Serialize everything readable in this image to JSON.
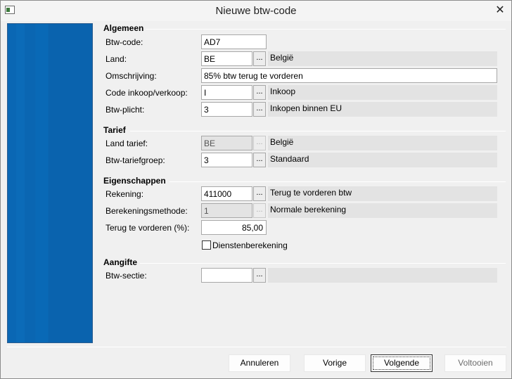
{
  "window": {
    "title": "Nieuwe btw-code",
    "close_glyph": "✕"
  },
  "sections": {
    "algemeen": "Algemeen",
    "tarief": "Tarief",
    "eigenschappen": "Eigenschappen",
    "aangifte": "Aangifte"
  },
  "form": {
    "btw_code": {
      "label": "Btw-code:",
      "value": "AD7"
    },
    "land": {
      "label": "Land:",
      "value": "BE",
      "description": "België"
    },
    "omschrijving": {
      "label": "Omschrijving:",
      "value": "85% btw terug te vorderen"
    },
    "code_inkoop_verkoop": {
      "label": "Code inkoop/verkoop:",
      "value": "I",
      "description": "Inkoop"
    },
    "btw_plicht": {
      "label": "Btw-plicht:",
      "value": "3",
      "description": "Inkopen binnen EU"
    },
    "land_tarief": {
      "label": "Land tarief:",
      "value": "BE",
      "description": "België"
    },
    "btw_tariefgroep": {
      "label": "Btw-tariefgroep:",
      "value": "3",
      "description": "Standaard"
    },
    "rekening": {
      "label": "Rekening:",
      "value": "411000",
      "description": "Terug te vorderen btw"
    },
    "berekeningsmethode": {
      "label": "Berekeningsmethode:",
      "value": "1",
      "description": "Normale berekening"
    },
    "terug_te_vorderen": {
      "label": "Terug te vorderen (%):",
      "value": "85,00"
    },
    "dienstenberekening": {
      "label": "Dienstenberekening",
      "checked": false
    },
    "btw_sectie": {
      "label": "Btw-sectie:",
      "value": "",
      "description": ""
    }
  },
  "browse_glyph": "...",
  "buttons": {
    "annuleren": "Annuleren",
    "vorige": "Vorige",
    "volgende": "Volgende",
    "voltooien": "Voltooien"
  }
}
